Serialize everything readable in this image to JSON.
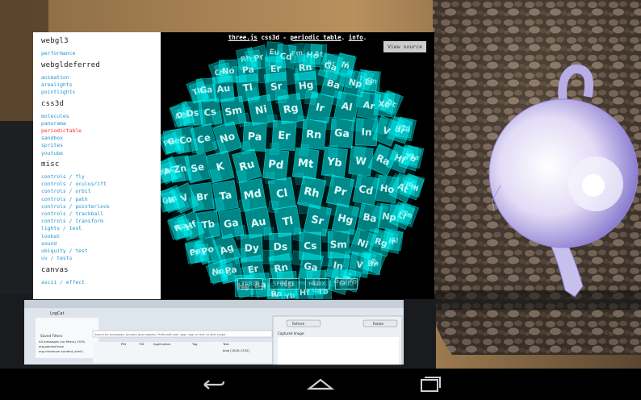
{
  "camera_scene": {
    "laptop_window": {
      "title": "LogCat",
      "saved_filters_label": "Saved Filters",
      "filter_item": "All messages (no filters) (329)",
      "filter_item_2": "org.gameof.rose",
      "filter_item_3": "org.chromium.content_shell (",
      "search_placeholder": "Search for messages. Accepts Java regexes. Prefix with pid:, app:, tag: or text: to limit scope.",
      "columns": [
        "PID",
        "TID",
        "Application",
        "Tag",
        "Text"
      ],
      "row_text": "blob [1828,1332]"
    },
    "dialog": {
      "refresh_label": "Refresh",
      "rotate_label": "Rotate",
      "captured_label": "Captured Image:"
    }
  },
  "sidebar": {
    "sections": [
      {
        "heading": "webgl3",
        "links": [
          "performance"
        ]
      },
      {
        "heading": "webgldeferred",
        "links": [
          "animation",
          "arealights",
          "pointlights"
        ]
      },
      {
        "heading": "css3d",
        "links": [
          "molecules",
          "panorama",
          "periodictable",
          "sandbox",
          "sprites",
          "youtube"
        ],
        "active": "periodictable"
      },
      {
        "heading": "misc",
        "links": [
          "controls / fly",
          "controls / oculusrift",
          "controls / orbit",
          "controls / path",
          "controls / pointerlock",
          "controls / trackball",
          "controls / transform",
          "lights / test",
          "lookat",
          "sound",
          "ubiquity / test",
          "uv / tests"
        ]
      },
      {
        "heading": "canvas",
        "links": [
          "ascii / effect"
        ]
      }
    ]
  },
  "viewport": {
    "info_link1": "three.js",
    "info_mid": " css3d - ",
    "info_link2": "periodic table",
    "info_sep": ". ",
    "info_link3": "info",
    "info_end": ".",
    "view_source_label": "View source",
    "layout_buttons": [
      "TABLE",
      "SPHERE",
      "HELIX",
      "GRID"
    ],
    "tile_color": "#00ffff",
    "elements": [
      "Yb",
      "W",
      "Ra",
      "Hf",
      "Tb",
      "Ga",
      "Au",
      "Tl",
      "Sr",
      "Hg",
      "Ba",
      "Np",
      "Li",
      "Sn",
      "Tm",
      "Rb",
      "Fr",
      "Ti",
      "Pu",
      "Ge",
      "Co",
      "Ce",
      "No",
      "Pa",
      "Er",
      "Rn",
      "Ga",
      "In",
      "V",
      "Br",
      "Ta",
      "Md",
      "Cl",
      "Rh",
      "Pr",
      "Cd",
      "Ho",
      "At",
      "Fm",
      "Eu",
      "Pm",
      "Po",
      "Ag",
      "Dy",
      "Ds",
      "Cs",
      "Sm",
      "Ni",
      "Rg",
      "Ir",
      "Al",
      "Ar",
      "Xe",
      "Ac",
      "Zn",
      "Se",
      "K",
      "Ru",
      "Pd",
      "Mt"
    ]
  },
  "nav": {
    "back_icon": "back-arrow-icon",
    "home_icon": "home-icon",
    "recents_icon": "recent-apps-icon"
  }
}
